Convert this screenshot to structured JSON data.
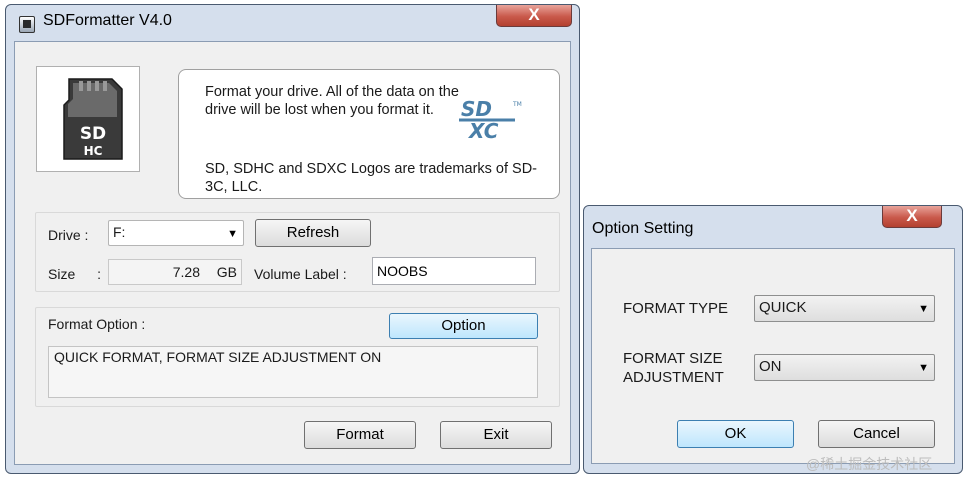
{
  "main_window": {
    "title": "SDFormatter V4.0",
    "close_symbol": "X",
    "info_text": "Format your drive. All of the data on the drive will be lost when you format it.",
    "trademark_text": "SD, SDHC and SDXC Logos are trademarks of SD-3C, LLC.",
    "card_logo": "SD HC",
    "sdxc_logo": "SD XC",
    "drive_label": "Drive :",
    "drive_value": "F:",
    "refresh_label": "Refresh",
    "size_label": "Size :",
    "size_value": "7.28",
    "size_unit": "GB",
    "volume_label": "Volume Label :",
    "volume_value": "NOOBS",
    "format_option_label": "Format Option :",
    "option_button": "Option",
    "option_summary": "QUICK FORMAT, FORMAT SIZE ADJUSTMENT ON",
    "format_button": "Format",
    "exit_button": "Exit"
  },
  "option_dialog": {
    "title": "Option Setting",
    "close_symbol": "X",
    "format_type_label": "FORMAT TYPE",
    "format_type_value": "QUICK",
    "format_size_label_1": "FORMAT SIZE",
    "format_size_label_2": "ADJUSTMENT",
    "format_size_value": "ON",
    "ok_button": "OK",
    "cancel_button": "Cancel"
  },
  "watermark": "@稀土掘金技术社区",
  "icons": {
    "app": "sd-card-app-icon",
    "dropdown": "chevron-down-icon",
    "close": "close-icon"
  }
}
